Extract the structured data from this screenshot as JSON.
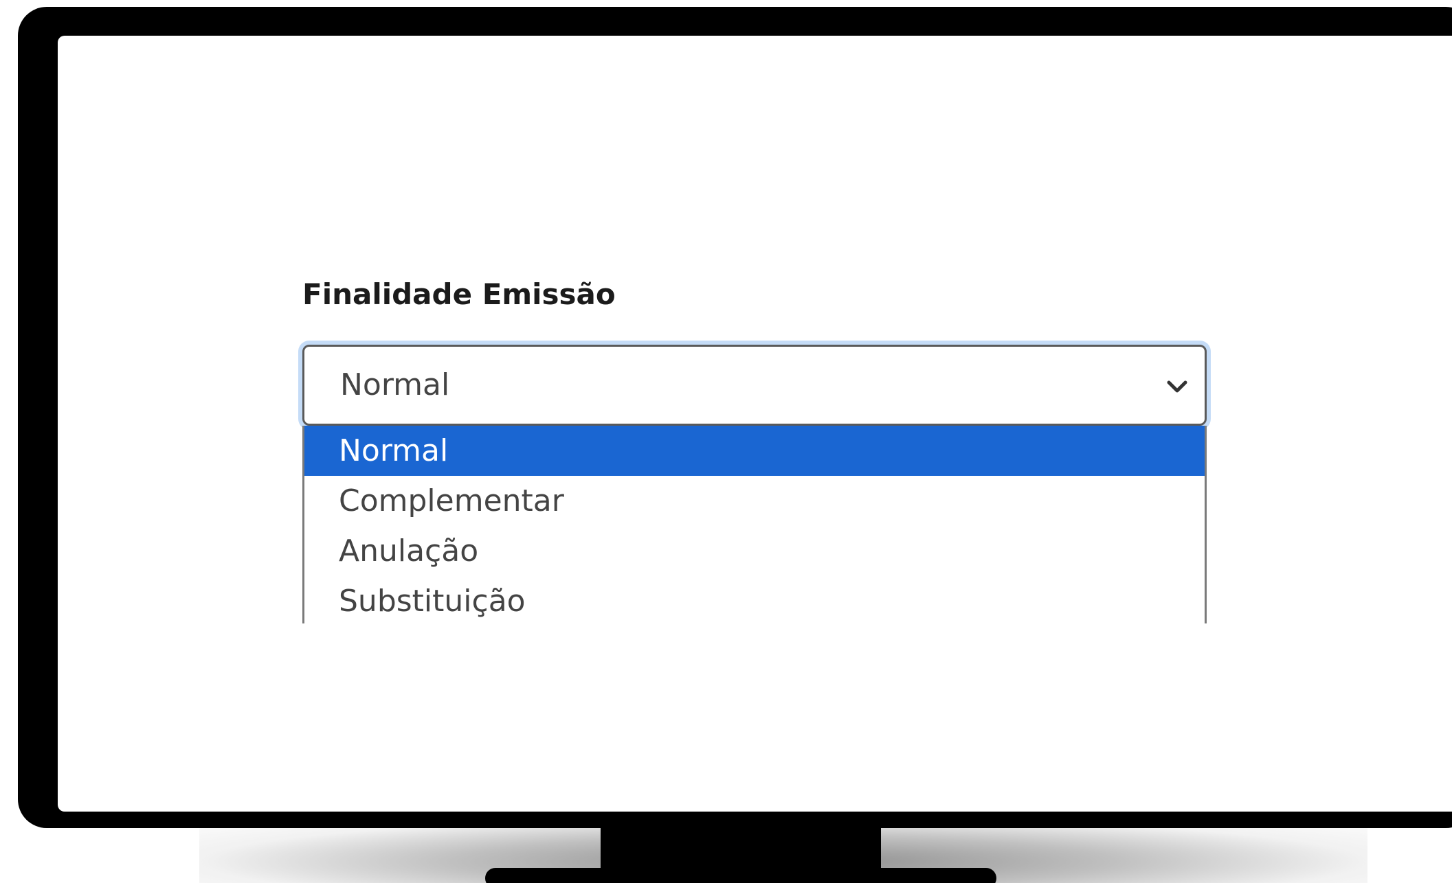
{
  "form": {
    "label": "Finalidade Emissão",
    "select": {
      "value": "Normal",
      "icon": "chevron-down-icon",
      "options": [
        {
          "label": "Normal",
          "selected": true
        },
        {
          "label": "Complementar",
          "selected": false
        },
        {
          "label": "Anulação",
          "selected": false
        },
        {
          "label": "Substituição",
          "selected": false
        }
      ]
    }
  },
  "colors": {
    "selected_option_bg": "#1a66d2",
    "focus_ring": "#c5dcf7",
    "monitor_frame": "#000000"
  }
}
